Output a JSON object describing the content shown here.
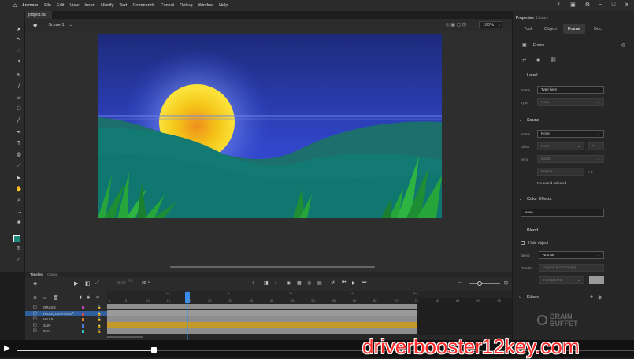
{
  "menubar": {
    "app_name": "Animate",
    "items": [
      "File",
      "Edit",
      "View",
      "Insert",
      "Modify",
      "Text",
      "Commands",
      "Control",
      "Debug",
      "Window",
      "Help"
    ]
  },
  "document_tab": "project.fla*",
  "scenebar": {
    "scene": "Scene 1",
    "zoom": "100%"
  },
  "timeline": {
    "tabs": [
      "Timeline",
      "Output"
    ],
    "fps": "15.00",
    "fps_unit": "FPS",
    "frame": "20",
    "ruler_seconds": [
      "1s",
      "2s",
      "3s",
      "4s",
      "5s"
    ],
    "ruler_frames": [
      "1",
      "5",
      "10",
      "15",
      "20",
      "25",
      "30",
      "35",
      "40",
      "45",
      "50",
      "55",
      "60",
      "65",
      "70",
      "75",
      "80",
      "85",
      "90",
      "95"
    ],
    "layers": [
      {
        "name": "GRASS",
        "swatch": "#c043c0"
      },
      {
        "name": "HILLS_LIGHTING",
        "swatch": "#d14c4c",
        "selected": true
      },
      {
        "name": "HILLS",
        "swatch": "#e07f2e"
      },
      {
        "name": "SUN",
        "swatch": "#4a7adf"
      },
      {
        "name": "SKY",
        "swatch": "#2fc4c4"
      }
    ]
  },
  "properties": {
    "tabs": [
      "Properties",
      "Library"
    ],
    "subtabs": [
      "Tool",
      "Object",
      "Frame",
      "Doc"
    ],
    "active_subtab": "Frame",
    "frame_title": "Frame",
    "label_section": "Label",
    "label_name_label": "Name",
    "label_name_placeholder": "Type here",
    "label_type_label": "Type",
    "label_type_value": "None",
    "sound_section": "Sound",
    "sound_name_label": "Name",
    "sound_name_value": "None",
    "sound_effect_label": "Effect",
    "sound_effect_value": "None",
    "sound_sync_label": "Sync",
    "sound_sync_value": "Event",
    "sound_repeat_value": "Repeat",
    "sound_repeat_count": "x 1",
    "sound_status": "No sound selected",
    "color_effects_section": "Color Effects",
    "color_effects_value": "None",
    "blend_section": "Blend",
    "hide_object_label": "Hide object",
    "blend_label": "Blend",
    "blend_value": "Normal",
    "render_label": "Render",
    "render_value": "Original (No Change)",
    "transparent_value": "Transparent",
    "filters_section": "Filters",
    "brand_line1": "BRAIN",
    "brand_line2": "BUFFET"
  },
  "watermark": "driverbooster12key.com",
  "video": {
    "progress": 0.27
  },
  "colors": {
    "accent": "#378ef0",
    "stage_sky_top": "#1d2a7a",
    "sun": "#f5c518",
    "hill_back": "#1c6f6c",
    "hill_front": "#126a68",
    "grass": "#25a53a"
  }
}
